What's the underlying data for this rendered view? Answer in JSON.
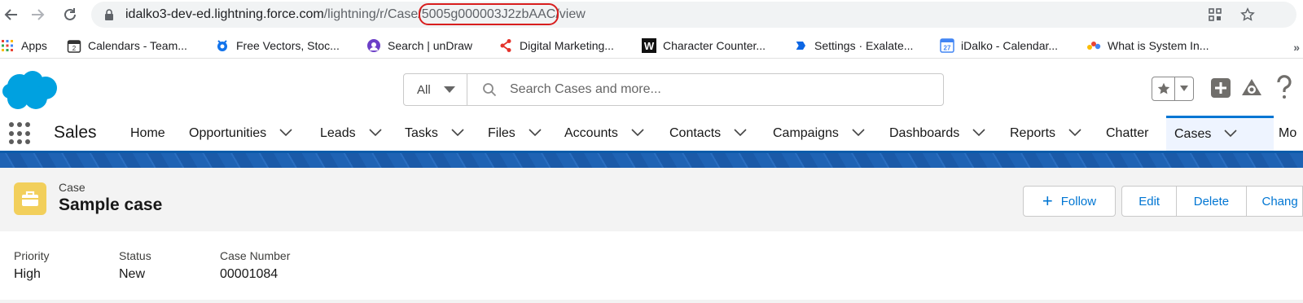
{
  "browser": {
    "url_host": "idalko3-dev-ed.lightning.force.com",
    "url_path_prefix": "/lightning/r/Case/",
    "url_record_id": "5005g000003J2zbAAC",
    "url_path_suffix": "/view"
  },
  "bookmarks": [
    {
      "label": "Apps",
      "icon": "apps-grid-icon"
    },
    {
      "label": "Calendars - Team...",
      "icon": "calendar-icon"
    },
    {
      "label": "Free Vectors, Stoc...",
      "icon": "freepik-icon"
    },
    {
      "label": "Search | unDraw",
      "icon": "undraw-icon"
    },
    {
      "label": "Digital Marketing...",
      "icon": "share-node-icon"
    },
    {
      "label": "Character Counter...",
      "icon": "w-logo-icon"
    },
    {
      "label": "Settings · Exalate...",
      "icon": "exalate-icon"
    },
    {
      "label": "iDalko - Calendar...",
      "icon": "google-calendar-icon"
    },
    {
      "label": "What is System In...",
      "icon": "dots-logo-icon"
    }
  ],
  "bookmarks_more": "»",
  "search": {
    "scope": "All",
    "placeholder": "Search Cases and more..."
  },
  "app_name": "Sales",
  "tabs": [
    {
      "label": "Home",
      "dropdown": false
    },
    {
      "label": "Opportunities",
      "dropdown": true
    },
    {
      "label": "Leads",
      "dropdown": true
    },
    {
      "label": "Tasks",
      "dropdown": true
    },
    {
      "label": "Files",
      "dropdown": true
    },
    {
      "label": "Accounts",
      "dropdown": true
    },
    {
      "label": "Contacts",
      "dropdown": true
    },
    {
      "label": "Campaigns",
      "dropdown": true
    },
    {
      "label": "Dashboards",
      "dropdown": true
    },
    {
      "label": "Reports",
      "dropdown": true
    },
    {
      "label": "Chatter",
      "dropdown": false
    },
    {
      "label": "Cases",
      "dropdown": true,
      "active": true
    },
    {
      "label": "Mo",
      "dropdown": false
    }
  ],
  "record": {
    "object_label": "Case",
    "title": "Sample case",
    "actions": {
      "follow": "Follow",
      "edit": "Edit",
      "delete": "Delete",
      "change": "Chang"
    },
    "fields": [
      {
        "label": "Priority",
        "value": "High"
      },
      {
        "label": "Status",
        "value": "New"
      },
      {
        "label": "Case Number",
        "value": "00001084"
      }
    ]
  },
  "colors": {
    "brand_blue": "#0176d3",
    "nav_border": "#0b5cab",
    "case_icon_bg": "#f2cf5b",
    "url_highlight": "#d81e1e"
  }
}
